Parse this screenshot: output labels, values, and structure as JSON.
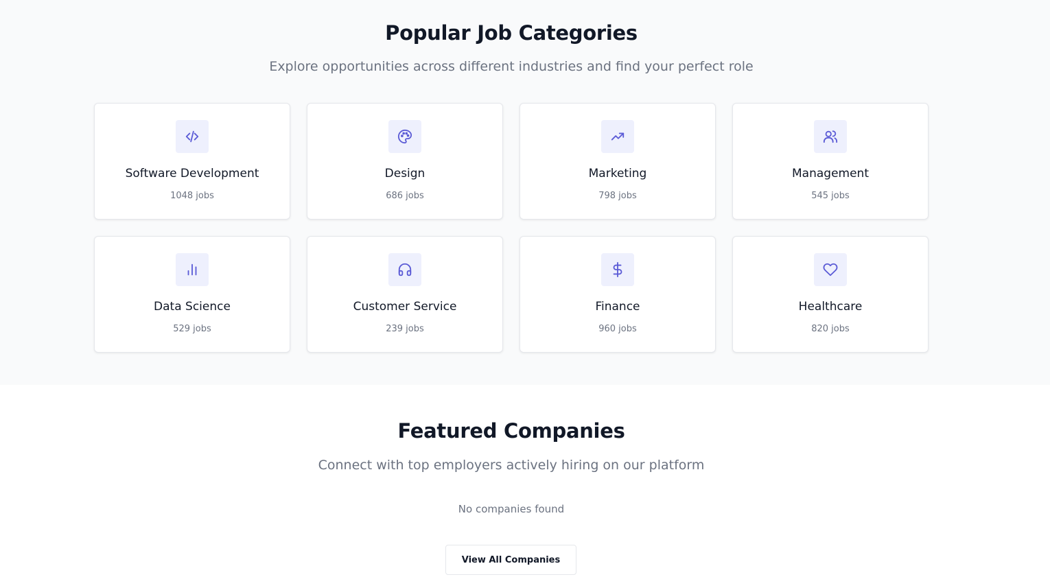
{
  "categories_section": {
    "title": "Popular Job Categories",
    "subtitle": "Explore opportunities across different industries and find your perfect role",
    "cards": [
      {
        "name": "Software Development",
        "count": "1048 jobs",
        "icon": "code-icon"
      },
      {
        "name": "Design",
        "count": "686 jobs",
        "icon": "palette-icon"
      },
      {
        "name": "Marketing",
        "count": "798 jobs",
        "icon": "trending-up-icon"
      },
      {
        "name": "Management",
        "count": "545 jobs",
        "icon": "users-icon"
      },
      {
        "name": "Data Science",
        "count": "529 jobs",
        "icon": "bar-chart-icon"
      },
      {
        "name": "Customer Service",
        "count": "239 jobs",
        "icon": "headphones-icon"
      },
      {
        "name": "Finance",
        "count": "960 jobs",
        "icon": "dollar-icon"
      },
      {
        "name": "Healthcare",
        "count": "820 jobs",
        "icon": "heart-icon"
      }
    ]
  },
  "companies_section": {
    "title": "Featured Companies",
    "subtitle": "Connect with top employers actively hiring on our platform",
    "empty_message": "No companies found",
    "view_all_label": "View All Companies"
  },
  "colors": {
    "accent": "#5b5bd6",
    "icon_bg": "#eef0fd",
    "section_bg": "#f9fafb",
    "heading": "#111827",
    "muted": "#6b7280"
  }
}
